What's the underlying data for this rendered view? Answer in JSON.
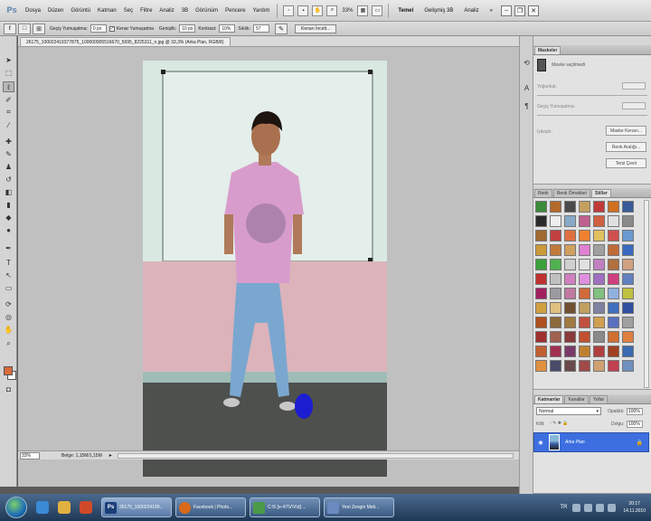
{
  "menubar": {
    "logo": "Ps",
    "items": [
      "Dosya",
      "Düzen",
      "Görüntü",
      "Katman",
      "Seç",
      "Filtre",
      "Analiz",
      "3B",
      "Görünüm",
      "Pencere",
      "Yardım"
    ],
    "zoom": "33%",
    "workspaces": [
      "Temel",
      "Gelişmiş 3B",
      "Analiz"
    ],
    "workspace_more": "»"
  },
  "options": {
    "feather_label": "Geçiş Yumuşatma:",
    "feather_value": "0 px",
    "antialias_label": "Kenar Yumuşatma",
    "width_label": "Genişlik:",
    "width_value": "10 px",
    "contrast_label": "Kontrast:",
    "contrast_value": "10%",
    "frequency_label": "Sıklık:",
    "frequency_value": "57",
    "refine_edge_label": "Kenarı İncelt..."
  },
  "document": {
    "tab_title": "26175_100022419377875_100000905516670_5695_8225311_n.jpg @ 33,3% (Arka Plan, RGB/8)",
    "status_zoom": "33%",
    "status_info": "Belge: 1,15M/1,15M"
  },
  "masks_panel": {
    "tab": "Maskeler",
    "subtitle": "Maske seçilmedi",
    "density_label": "Yoğunluk:",
    "feather_label": "Geçiş Yumuşatma:",
    "refine_label": "İyileştir:",
    "btn_mask_edge": "Maske Kenarı...",
    "btn_color_range": "Renk Aralığı...",
    "btn_invert": "Tersi Çevir"
  },
  "styles_panel": {
    "tabs": [
      "Renk",
      "Renk Örnekleri",
      "Stiller"
    ],
    "swatches": [
      "#3a8a3a",
      "#b46a2a",
      "#4a4a4a",
      "#c4a060",
      "#c03a3a",
      "#d07020",
      "#3a5a9a",
      "#2a2a2a",
      "#eeeeee",
      "#88aac8",
      "#c06090",
      "#d06040",
      "#e0e0e0",
      "#8a8a8a",
      "#a06a30",
      "#c04040",
      "#e07040",
      "#f08030",
      "#e0c060",
      "#d05050",
      "#6a9ad0",
      "#cc9a3a",
      "#c07a3a",
      "#d0a060",
      "#e080d0",
      "#a0a0a0",
      "#c06a3a",
      "#3a6ac0",
      "#3aa03a",
      "#50b050",
      "#d0d0d0",
      "#e0e0e0",
      "#c080c0",
      "#b07040",
      "#d0a080",
      "#c03030",
      "#c0c0c0",
      "#d080c0",
      "#e090e0",
      "#a070c0",
      "#d04080",
      "#6080c0",
      "#a02060",
      "#9a9aa0",
      "#c07aa0",
      "#d06a3a",
      "#80c080",
      "#90b0e0",
      "#c0c040",
      "#d0a040",
      "#e0c080",
      "#705030",
      "#c0a060",
      "#8080a0",
      "#4070c0",
      "#3050a0",
      "#b05020",
      "#8a6a3a",
      "#a07a40",
      "#c05040",
      "#d0a050",
      "#5a70c0",
      "#a0a0a0",
      "#a03030",
      "#a06050",
      "#8a3a3a",
      "#c05030",
      "#8a8a8a",
      "#d07030",
      "#e08040",
      "#c06030",
      "#a03050",
      "#7a3a6a",
      "#c08030",
      "#b04040",
      "#a04020",
      "#3a6ab0",
      "#e09040",
      "#4a4a6a",
      "#6a4a4a",
      "#a04a4a",
      "#d0a070",
      "#c04050",
      "#7090c0"
    ]
  },
  "layers_panel": {
    "tabs": [
      "Katmanlar",
      "Kanallar",
      "Yollar"
    ],
    "blend_mode": "Normal",
    "opacity_label": "Opaklık:",
    "opacity_value": "100%",
    "lock_label": "Kilit:",
    "fill_label": "Dolgu:",
    "fill_value": "100%",
    "layer_name": "Arka Plan"
  },
  "taskbar": {
    "tasks": [
      {
        "label": "26175_1000224199...",
        "icon": "Ps",
        "color": "#1b3e7a"
      },
      {
        "label": "Facebook | Photo...",
        "icon": "ff",
        "color": "#d86a1a"
      },
      {
        "label": "C:\\5 [e-47\\V\\V\\d] ...",
        "icon": "C",
        "color": "#4a9a4a"
      },
      {
        "label": "Yeni Zengin Meti...",
        "icon": "W",
        "color": "#6a8ac0"
      }
    ],
    "lang": "TR",
    "time": "20:17",
    "date": "14.11.2010"
  }
}
